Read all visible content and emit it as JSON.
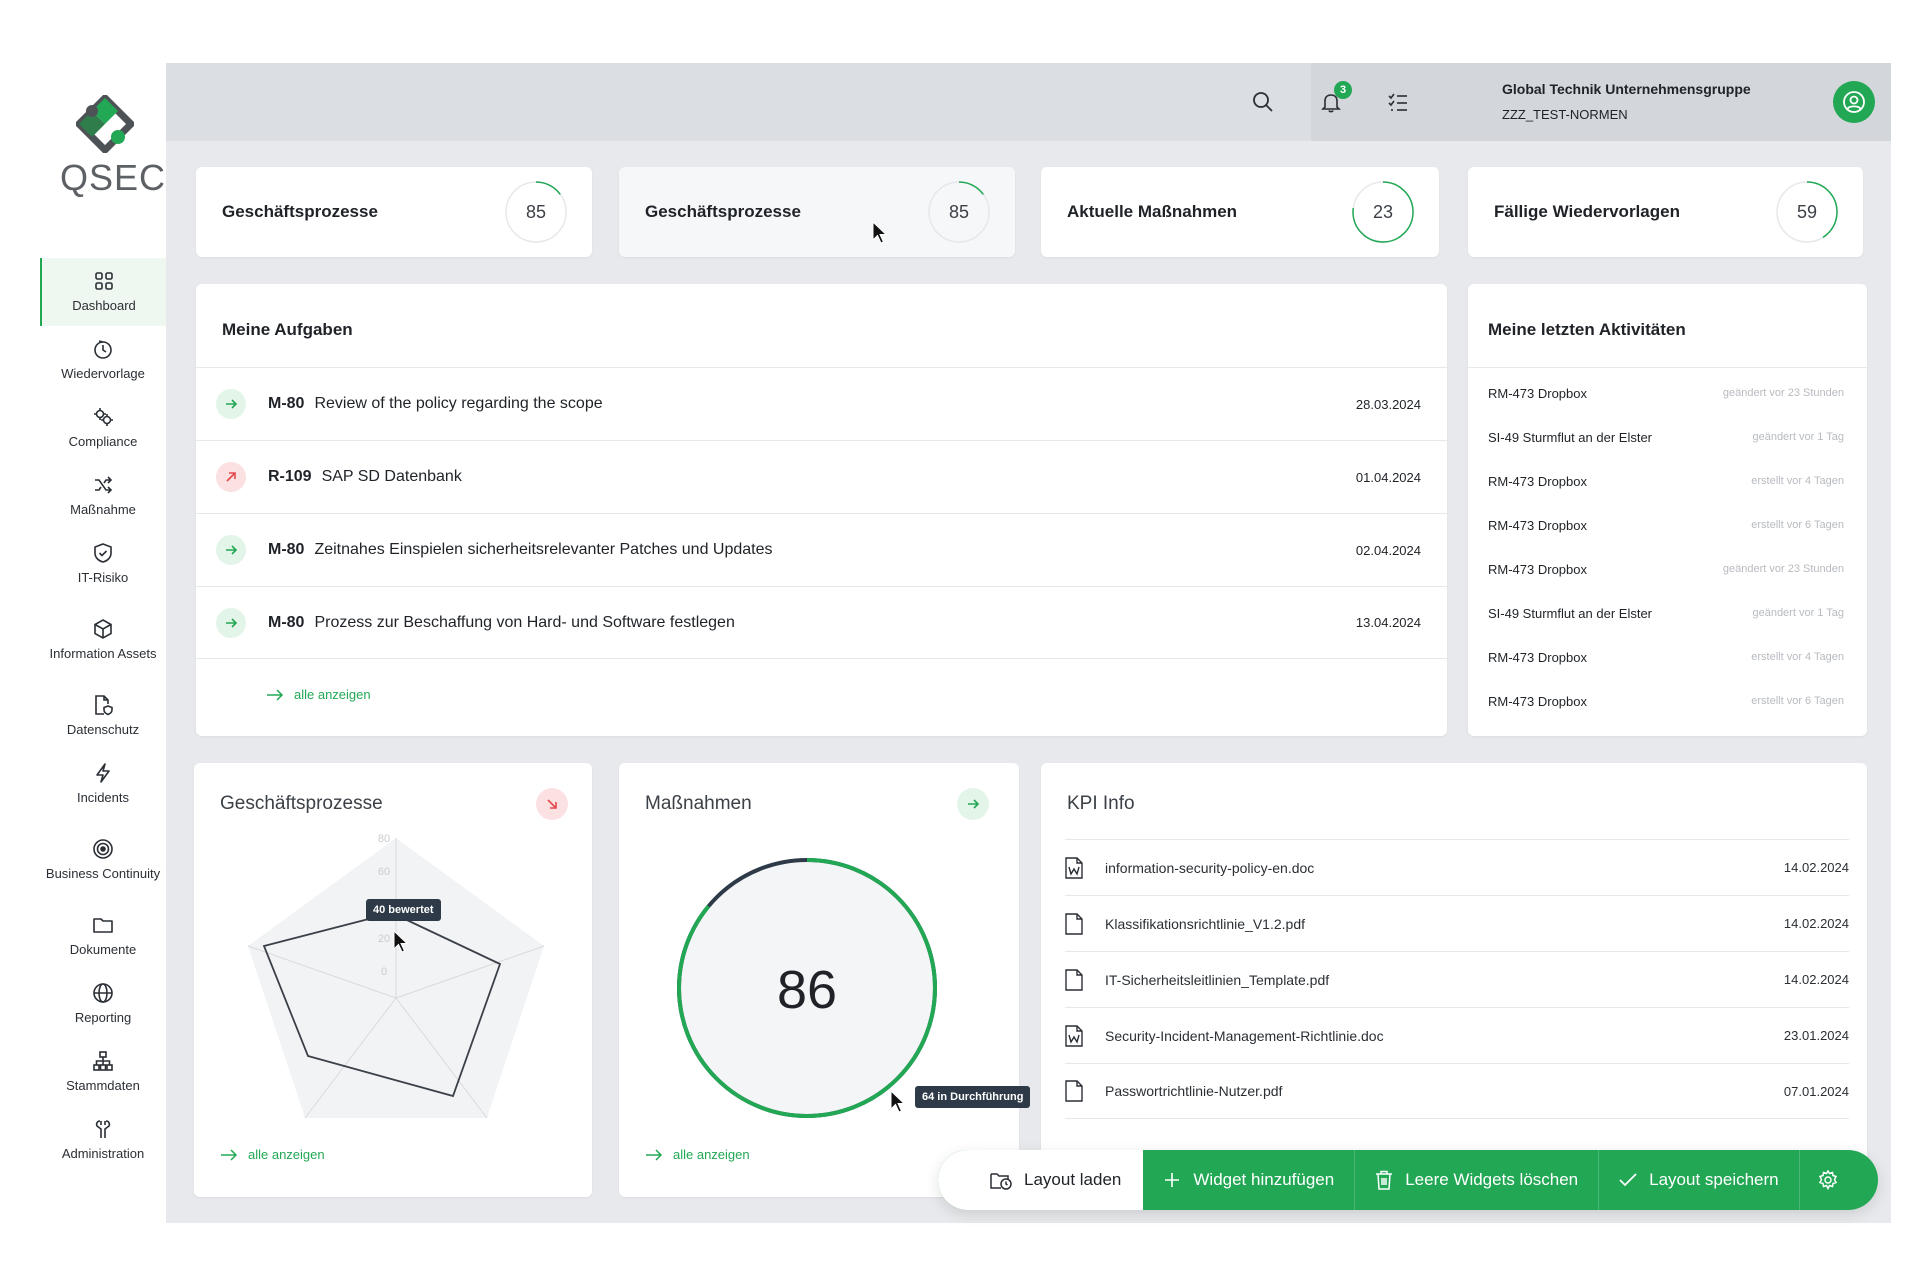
{
  "app": {
    "logo_text": "QSEC",
    "brand_color": "#22a855",
    "danger_color": "#e5484d"
  },
  "sidebar": {
    "items": [
      {
        "label": "Dashboard",
        "icon": "grid-icon",
        "active": true
      },
      {
        "label": "Wiedervorlage",
        "icon": "clock-icon"
      },
      {
        "label": "Compliance",
        "icon": "gears-icon"
      },
      {
        "label": "Maßnahme",
        "icon": "shuffle-icon"
      },
      {
        "label": "IT-Risiko",
        "icon": "shield-icon"
      },
      {
        "label": "Information Assets",
        "icon": "cube-icon"
      },
      {
        "label": "Datenschutz",
        "icon": "file-shield-icon"
      },
      {
        "label": "Incidents",
        "icon": "lightning-icon"
      },
      {
        "label": "Business Continuity",
        "icon": "target-icon"
      },
      {
        "label": "Dokumente",
        "icon": "folder-icon"
      },
      {
        "label": "Reporting",
        "icon": "globe-icon"
      },
      {
        "label": "Stammdaten",
        "icon": "hierarchy-icon"
      },
      {
        "label": "Administration",
        "icon": "tools-icon"
      }
    ]
  },
  "topbar": {
    "notification_count": "3",
    "org_name": "Global Technik Unternehmensgruppe",
    "org_sub": "ZZZ_TEST-NORMEN"
  },
  "kpis": [
    {
      "label": "Geschäftsprozesse",
      "value": "85",
      "fill": 0.15
    },
    {
      "label": "Geschäftsprozesse",
      "value": "85",
      "fill": 0.15
    },
    {
      "label": "Aktuelle Maßnahmen",
      "value": "23",
      "fill": 0.77
    },
    {
      "label": "Fällige Wiedervorlagen",
      "value": "59",
      "fill": 0.41
    }
  ],
  "tasks": {
    "title": "Meine Aufgaben",
    "rows": [
      {
        "code": "M-80",
        "text": "Review of the policy regarding the scope",
        "date": "28.03.2024",
        "status": "ok"
      },
      {
        "code": "R-109",
        "text": "SAP SD Datenbank",
        "date": "01.04.2024",
        "status": "warn"
      },
      {
        "code": "M-80",
        "text": "Zeitnahes Einspielen sicherheitsrelevanter Patches und Updates",
        "date": "02.04.2024",
        "status": "ok"
      },
      {
        "code": "M-80",
        "text": "Prozess zur Beschaffung von Hard- und Software festlegen",
        "date": "13.04.2024",
        "status": "ok"
      }
    ],
    "show_all": "alle anzeigen"
  },
  "activities": {
    "title": "Meine letzten Aktivitäten",
    "rows": [
      {
        "name": "RM-473 Dropbox",
        "meta": "geändert vor 23 Stunden"
      },
      {
        "name": "SI-49 Sturmflut an der Elster",
        "meta": "geändert vor 1 Tag"
      },
      {
        "name": "RM-473 Dropbox",
        "meta": "erstellt vor 4 Tagen"
      },
      {
        "name": "RM-473 Dropbox",
        "meta": "erstellt vor 6 Tagen"
      },
      {
        "name": "RM-473 Dropbox",
        "meta": "geändert vor 23 Stunden"
      },
      {
        "name": "SI-49 Sturmflut an der Elster",
        "meta": "geändert vor 1 Tag"
      },
      {
        "name": "RM-473 Dropbox",
        "meta": "erstellt vor 4 Tagen"
      },
      {
        "name": "RM-473 Dropbox",
        "meta": "erstellt vor 6 Tagen"
      }
    ]
  },
  "radar_widget": {
    "title": "Geschäftsprozesse",
    "tooltip": "40 bewertet",
    "show_all": "alle anzeigen",
    "scale_labels": [
      "80",
      "60",
      "40",
      "20",
      "0"
    ]
  },
  "gauge_widget": {
    "title": "Maßnahmen",
    "value": "86",
    "tooltip": "64 in Durchführung",
    "progress": 0.86,
    "show_all": "alle anzeigen"
  },
  "kpi_info": {
    "title": "KPI Info",
    "files": [
      {
        "name": "information-security-policy-en.doc",
        "date": "14.02.2024",
        "type": "word-doc-icon"
      },
      {
        "name": "Klassifikationsrichtlinie_V1.2.pdf",
        "date": "14.02.2024",
        "type": "file-icon"
      },
      {
        "name": "IT-Sicherheitsleitlinien_Template.pdf",
        "date": "14.02.2024",
        "type": "file-icon"
      },
      {
        "name": "Security-Incident-Management-Richtlinie.doc",
        "date": "23.01.2024",
        "type": "word-doc-icon"
      },
      {
        "name": "Passwortrichtlinie-Nutzer.pdf",
        "date": "07.01.2024",
        "type": "file-icon"
      }
    ]
  },
  "toolbar": {
    "load": "Layout laden",
    "add": "Widget hinzufügen",
    "clear": "Leere Widgets löschen",
    "save": "Layout speichern"
  }
}
